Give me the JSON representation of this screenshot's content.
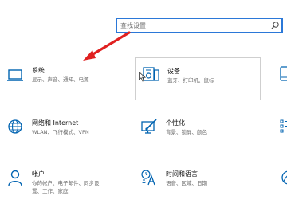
{
  "search": {
    "placeholder": "查找设置"
  },
  "tiles": {
    "system": {
      "title": "系统",
      "subtitle": "显示、声音、通知、电源",
      "icon": "laptop-icon"
    },
    "devices": {
      "title": "设备",
      "subtitle": "蓝牙、打印机、鼠标",
      "icon": "keyboard-speaker-icon"
    },
    "network": {
      "title": "网络和 Internet",
      "subtitle": "WLAN、飞行模式、VPN",
      "icon": "globe-icon"
    },
    "personalization": {
      "title": "个性化",
      "subtitle": "背景、锁屏、颜色",
      "icon": "paintbrush-icon"
    },
    "accounts": {
      "title": "帐户",
      "subtitle": "你的帐户、电子邮件、同步设置、工作、家庭",
      "subtitle_line1": "你的帐户、电子邮件、同步设",
      "subtitle_line2": "置、工作、家庭",
      "icon": "person-icon"
    },
    "time_language": {
      "title": "时间和语言",
      "subtitle": "语音、区域、日期",
      "icon": "time-language-icon"
    }
  },
  "colors": {
    "accent": "#0063b1",
    "search_border": "#2b78d8",
    "arrow": "#e02020"
  }
}
